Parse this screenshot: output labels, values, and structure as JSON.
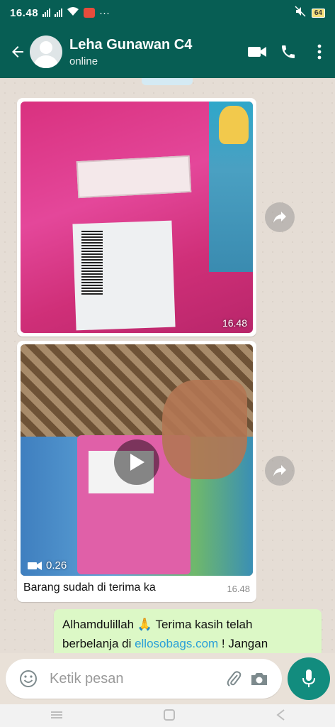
{
  "status_bar": {
    "time": "16.48",
    "more_indicator": "···",
    "battery": "64"
  },
  "header": {
    "contact_name": "Leha Gunawan C4",
    "contact_status": "online",
    "icons": [
      "back-arrow-icon",
      "avatar",
      "video-call-icon",
      "phone-icon",
      "more-vert-icon"
    ]
  },
  "messages": [
    {
      "type": "image",
      "direction": "in",
      "time": "16.48"
    },
    {
      "type": "video",
      "direction": "in",
      "duration": "0.26",
      "caption": "Barang sudah di terima ka",
      "time": "16.48"
    },
    {
      "type": "text",
      "direction": "out",
      "text_before_emoji": "Alhamdulillah",
      "emoji": "🙏",
      "text_after_emoji": " Terima kasih telah",
      "line2_before_link": "berbelanja di ",
      "link": "ellosobags.com",
      "line2_after_link": " ! Jangan"
    }
  ],
  "composer": {
    "placeholder": "Ketik pesan",
    "icons": [
      "emoji-icon",
      "attach-icon",
      "camera-icon",
      "mic-icon"
    ]
  },
  "colors": {
    "header": "#075e54",
    "outgoing_bubble": "#dcf8c6",
    "mic_button": "#128c7e",
    "link": "#2a9fd8"
  }
}
